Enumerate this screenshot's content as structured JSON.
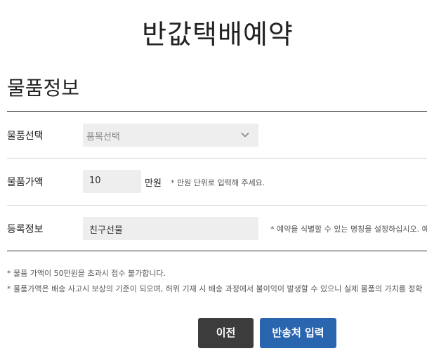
{
  "page_title": "반값택배예약",
  "section_title": "물품정보",
  "item_select": {
    "label": "물품선택",
    "value": "품목선택",
    "icon": "chevron-down-icon"
  },
  "item_price": {
    "label": "물품가액",
    "value": "10",
    "unit": "만원",
    "hint": "* 만원 단위로 입력해 주세요."
  },
  "registration": {
    "label": "등록정보",
    "value": "친구선물",
    "hint": "* 예약을 식별할 수 있는 명칭을 설정하십시오. 예"
  },
  "notes": [
    "* 물품 가액이 50만원을 초과시 접수 불가합니다.",
    "* 물품가액은 배송 사고시 보상의 기준이 되오며, 허위 기재 시 배송 과정에서 불이익이 발생할 수 있으니 실제 물품의 가치를 정확"
  ],
  "buttons": {
    "prev": "이전",
    "next": "반송처 입력"
  },
  "colors": {
    "prev_button": "#3c3c3c",
    "next_button": "#2a65b0",
    "field_background": "#eeeeee"
  }
}
